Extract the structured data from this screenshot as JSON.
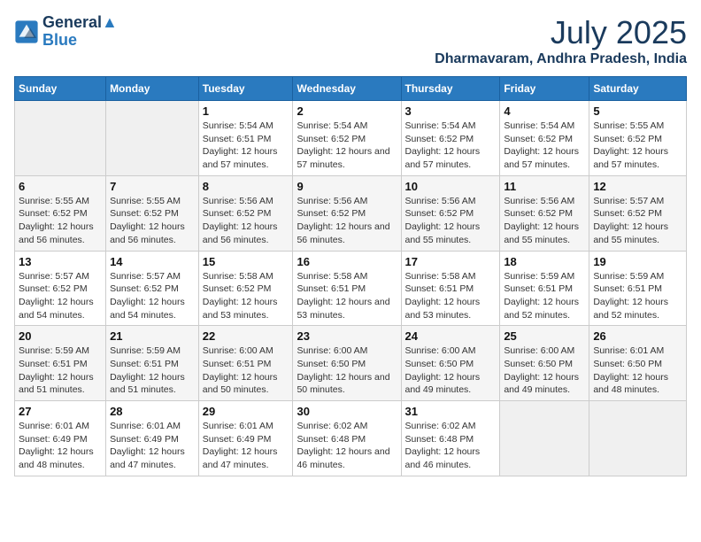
{
  "header": {
    "logo_line1": "General",
    "logo_line2": "Blue",
    "month": "July 2025",
    "location": "Dharmavaram, Andhra Pradesh, India"
  },
  "weekdays": [
    "Sunday",
    "Monday",
    "Tuesday",
    "Wednesday",
    "Thursday",
    "Friday",
    "Saturday"
  ],
  "weeks": [
    [
      {
        "day": "",
        "content": ""
      },
      {
        "day": "",
        "content": ""
      },
      {
        "day": "1",
        "content": "Sunrise: 5:54 AM\nSunset: 6:51 PM\nDaylight: 12 hours and 57 minutes."
      },
      {
        "day": "2",
        "content": "Sunrise: 5:54 AM\nSunset: 6:52 PM\nDaylight: 12 hours and 57 minutes."
      },
      {
        "day": "3",
        "content": "Sunrise: 5:54 AM\nSunset: 6:52 PM\nDaylight: 12 hours and 57 minutes."
      },
      {
        "day": "4",
        "content": "Sunrise: 5:54 AM\nSunset: 6:52 PM\nDaylight: 12 hours and 57 minutes."
      },
      {
        "day": "5",
        "content": "Sunrise: 5:55 AM\nSunset: 6:52 PM\nDaylight: 12 hours and 57 minutes."
      }
    ],
    [
      {
        "day": "6",
        "content": "Sunrise: 5:55 AM\nSunset: 6:52 PM\nDaylight: 12 hours and 56 minutes."
      },
      {
        "day": "7",
        "content": "Sunrise: 5:55 AM\nSunset: 6:52 PM\nDaylight: 12 hours and 56 minutes."
      },
      {
        "day": "8",
        "content": "Sunrise: 5:56 AM\nSunset: 6:52 PM\nDaylight: 12 hours and 56 minutes."
      },
      {
        "day": "9",
        "content": "Sunrise: 5:56 AM\nSunset: 6:52 PM\nDaylight: 12 hours and 56 minutes."
      },
      {
        "day": "10",
        "content": "Sunrise: 5:56 AM\nSunset: 6:52 PM\nDaylight: 12 hours and 55 minutes."
      },
      {
        "day": "11",
        "content": "Sunrise: 5:56 AM\nSunset: 6:52 PM\nDaylight: 12 hours and 55 minutes."
      },
      {
        "day": "12",
        "content": "Sunrise: 5:57 AM\nSunset: 6:52 PM\nDaylight: 12 hours and 55 minutes."
      }
    ],
    [
      {
        "day": "13",
        "content": "Sunrise: 5:57 AM\nSunset: 6:52 PM\nDaylight: 12 hours and 54 minutes."
      },
      {
        "day": "14",
        "content": "Sunrise: 5:57 AM\nSunset: 6:52 PM\nDaylight: 12 hours and 54 minutes."
      },
      {
        "day": "15",
        "content": "Sunrise: 5:58 AM\nSunset: 6:52 PM\nDaylight: 12 hours and 53 minutes."
      },
      {
        "day": "16",
        "content": "Sunrise: 5:58 AM\nSunset: 6:51 PM\nDaylight: 12 hours and 53 minutes."
      },
      {
        "day": "17",
        "content": "Sunrise: 5:58 AM\nSunset: 6:51 PM\nDaylight: 12 hours and 53 minutes."
      },
      {
        "day": "18",
        "content": "Sunrise: 5:59 AM\nSunset: 6:51 PM\nDaylight: 12 hours and 52 minutes."
      },
      {
        "day": "19",
        "content": "Sunrise: 5:59 AM\nSunset: 6:51 PM\nDaylight: 12 hours and 52 minutes."
      }
    ],
    [
      {
        "day": "20",
        "content": "Sunrise: 5:59 AM\nSunset: 6:51 PM\nDaylight: 12 hours and 51 minutes."
      },
      {
        "day": "21",
        "content": "Sunrise: 5:59 AM\nSunset: 6:51 PM\nDaylight: 12 hours and 51 minutes."
      },
      {
        "day": "22",
        "content": "Sunrise: 6:00 AM\nSunset: 6:51 PM\nDaylight: 12 hours and 50 minutes."
      },
      {
        "day": "23",
        "content": "Sunrise: 6:00 AM\nSunset: 6:50 PM\nDaylight: 12 hours and 50 minutes."
      },
      {
        "day": "24",
        "content": "Sunrise: 6:00 AM\nSunset: 6:50 PM\nDaylight: 12 hours and 49 minutes."
      },
      {
        "day": "25",
        "content": "Sunrise: 6:00 AM\nSunset: 6:50 PM\nDaylight: 12 hours and 49 minutes."
      },
      {
        "day": "26",
        "content": "Sunrise: 6:01 AM\nSunset: 6:50 PM\nDaylight: 12 hours and 48 minutes."
      }
    ],
    [
      {
        "day": "27",
        "content": "Sunrise: 6:01 AM\nSunset: 6:49 PM\nDaylight: 12 hours and 48 minutes."
      },
      {
        "day": "28",
        "content": "Sunrise: 6:01 AM\nSunset: 6:49 PM\nDaylight: 12 hours and 47 minutes."
      },
      {
        "day": "29",
        "content": "Sunrise: 6:01 AM\nSunset: 6:49 PM\nDaylight: 12 hours and 47 minutes."
      },
      {
        "day": "30",
        "content": "Sunrise: 6:02 AM\nSunset: 6:48 PM\nDaylight: 12 hours and 46 minutes."
      },
      {
        "day": "31",
        "content": "Sunrise: 6:02 AM\nSunset: 6:48 PM\nDaylight: 12 hours and 46 minutes."
      },
      {
        "day": "",
        "content": ""
      },
      {
        "day": "",
        "content": ""
      }
    ]
  ]
}
